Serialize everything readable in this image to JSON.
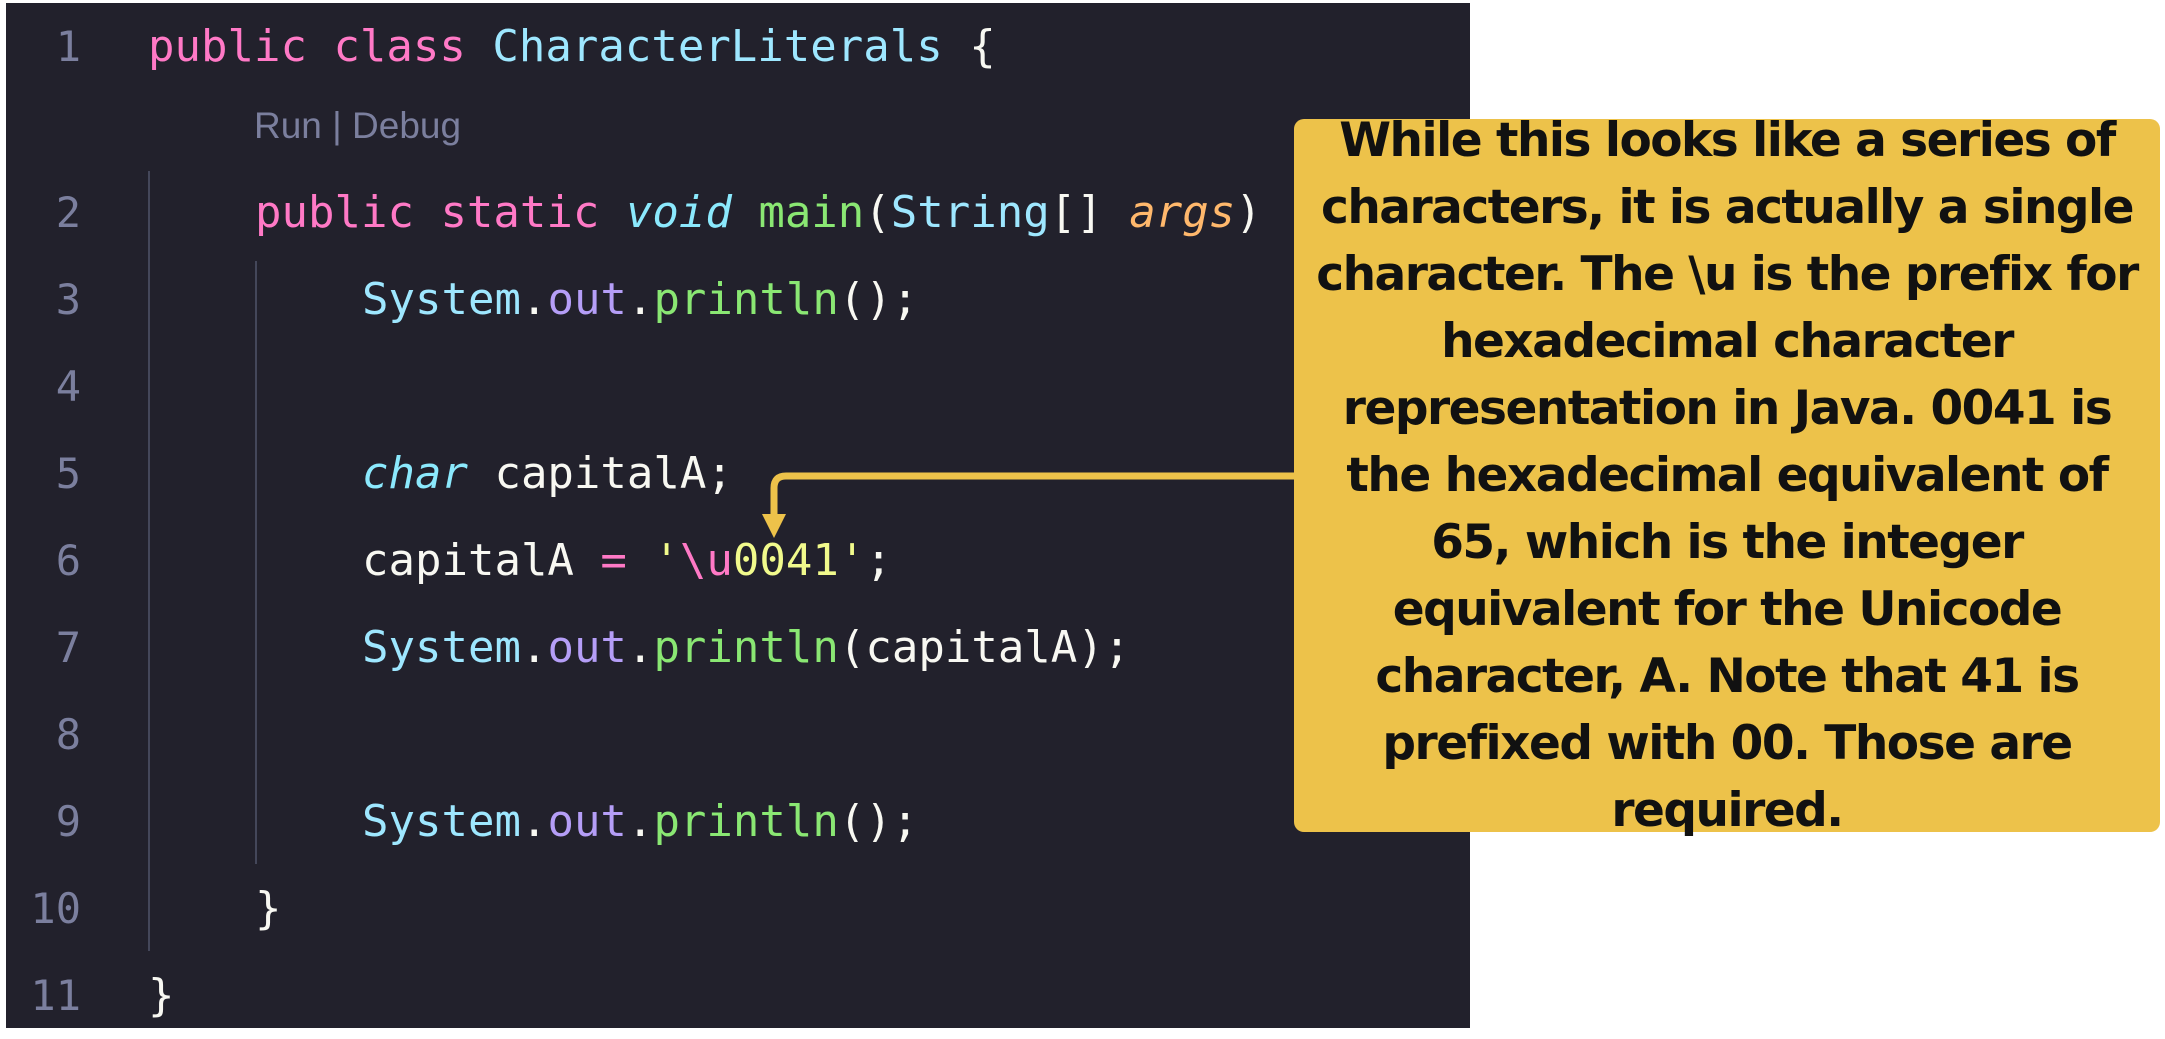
{
  "editor": {
    "codelens": "Run | Debug",
    "lines": [
      {
        "n": "1",
        "tokens": [
          [
            "kw",
            "public "
          ],
          [
            "kw",
            "class "
          ],
          [
            "cls",
            "CharacterLiterals"
          ],
          [
            "plain",
            " {"
          ]
        ]
      },
      {
        "n": "2",
        "tokens": [
          [
            "kw",
            "public "
          ],
          [
            "kw",
            "static "
          ],
          [
            "it",
            "void "
          ],
          [
            "fn",
            "main"
          ],
          [
            "plain",
            "("
          ],
          [
            "cls",
            "String"
          ],
          [
            "plain",
            "[] "
          ],
          [
            "arg",
            "args"
          ],
          [
            "plain",
            ")"
          ]
        ]
      },
      {
        "n": "3",
        "tokens": [
          [
            "cls",
            "System"
          ],
          [
            "plain",
            "."
          ],
          [
            "prop",
            "out"
          ],
          [
            "plain",
            "."
          ],
          [
            "fn",
            "println"
          ],
          [
            "plain",
            "();"
          ]
        ]
      },
      {
        "n": "4",
        "tokens": []
      },
      {
        "n": "5",
        "tokens": [
          [
            "it",
            "char "
          ],
          [
            "plain",
            "capitalA;"
          ]
        ]
      },
      {
        "n": "6",
        "tokens": [
          [
            "plain",
            "capitalA "
          ],
          [
            "op",
            "="
          ],
          [
            "plain",
            " "
          ],
          [
            "str",
            "'"
          ],
          [
            "esc",
            "\\u"
          ],
          [
            "str",
            "0041'"
          ],
          [
            "plain",
            ";"
          ]
        ]
      },
      {
        "n": "7",
        "tokens": [
          [
            "cls",
            "System"
          ],
          [
            "plain",
            "."
          ],
          [
            "prop",
            "out"
          ],
          [
            "plain",
            "."
          ],
          [
            "fn",
            "println"
          ],
          [
            "plain",
            "(capitalA);"
          ]
        ]
      },
      {
        "n": "8",
        "tokens": []
      },
      {
        "n": "9",
        "tokens": [
          [
            "cls",
            "System"
          ],
          [
            "plain",
            "."
          ],
          [
            "prop",
            "out"
          ],
          [
            "plain",
            "."
          ],
          [
            "fn",
            "println"
          ],
          [
            "plain",
            "();"
          ]
        ]
      },
      {
        "n": "10",
        "tokens": [
          [
            "plain",
            "}"
          ]
        ]
      },
      {
        "n": "11",
        "tokens": [
          [
            "plain",
            "}"
          ]
        ]
      }
    ]
  },
  "callout": {
    "text": "While this looks like a series of characters, it is actually a single character. The \\u is the prefix for hexadecimal character representation in Java. 0041 is the hexadecimal equivalent of 65, which is the integer equivalent for the Unicode character, A. Note that 41 is prefixed with 00. Those are required."
  },
  "colors": {
    "editor_background": "#22212c",
    "callout_background": "#edc24a",
    "arrow": "#edc24a"
  }
}
